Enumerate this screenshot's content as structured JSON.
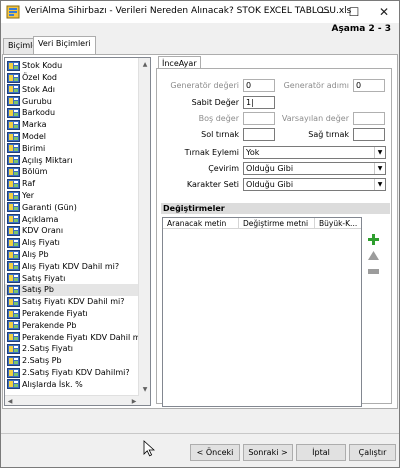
{
  "window": {
    "title": "VeriAlma Sihirbazı - Verileri Nereden Alınacak? STOK EXCEL TABLOSU.xls",
    "step": "Aşama 2 - 3",
    "minimize_glyph": "—",
    "maximize_glyph": "☐",
    "close_glyph": "✕"
  },
  "tabs": [
    {
      "label": "Biçimler"
    },
    {
      "label": "Veri Biçimleri"
    }
  ],
  "field_list": {
    "items": [
      "Stok Kodu",
      "Özel Kod",
      "Stok Adı",
      "Gurubu",
      "Barkodu",
      "Marka",
      "Model",
      "Birimi",
      "Açılış Miktarı",
      "Bölüm",
      "Raf",
      "Yer",
      "Garanti (Gün)",
      "Açıklama",
      "KDV Oranı",
      "Alış Fiyatı",
      "Alış Pb",
      "Alış Fiyatı KDV Dahil mi?",
      "Satış Fiyatı",
      "Satış Pb",
      "Satış Fiyatı KDV Dahil mi?",
      "Perakende Fiyatı",
      "Perakende Pb",
      "Perakende Fiyatı KDV Dahil mi?",
      "2.Satış Fiyatı",
      "2.Satış Pb",
      "2.Satış Fiyatı KDV Dahilmi?",
      "Alışlarda İsk. %"
    ],
    "selected_index": 19
  },
  "settings": {
    "tab_label": "İnceAyar",
    "generator_value_label": "Generatör değeri",
    "generator_value": "0",
    "generator_name_label": "Generatör adımı",
    "generator_name": "0",
    "fixed_value_label": "Sabit Değer",
    "fixed_value": "1|",
    "empty_value_label": "Boş değer",
    "empty_value": "",
    "default_value_label": "Varsayılan değer",
    "default_value": "",
    "left_quote_label": "Sol tırnak",
    "left_quote": "",
    "right_quote_label": "Sağ tırnak",
    "right_quote": "",
    "quote_action_label": "Tırnak Eylemi",
    "quote_action": "Yok",
    "conversion_label": "Çevirim",
    "conversion": "Olduğu Gibi",
    "charset_label": "Karakter Seti",
    "charset": "Olduğu Gibi",
    "changes_header": "Değiştirmeler",
    "columns": [
      "Aranacak metin",
      "Değiştirme metni",
      "Büyük-K..."
    ]
  },
  "buttons": {
    "back": "< Önceki",
    "next": "Sonraki >",
    "cancel": "İptal",
    "run": "Çalıştır"
  },
  "colors": {
    "add_green": "#2e9e2e",
    "disabled_gray": "#9c9c9c"
  }
}
